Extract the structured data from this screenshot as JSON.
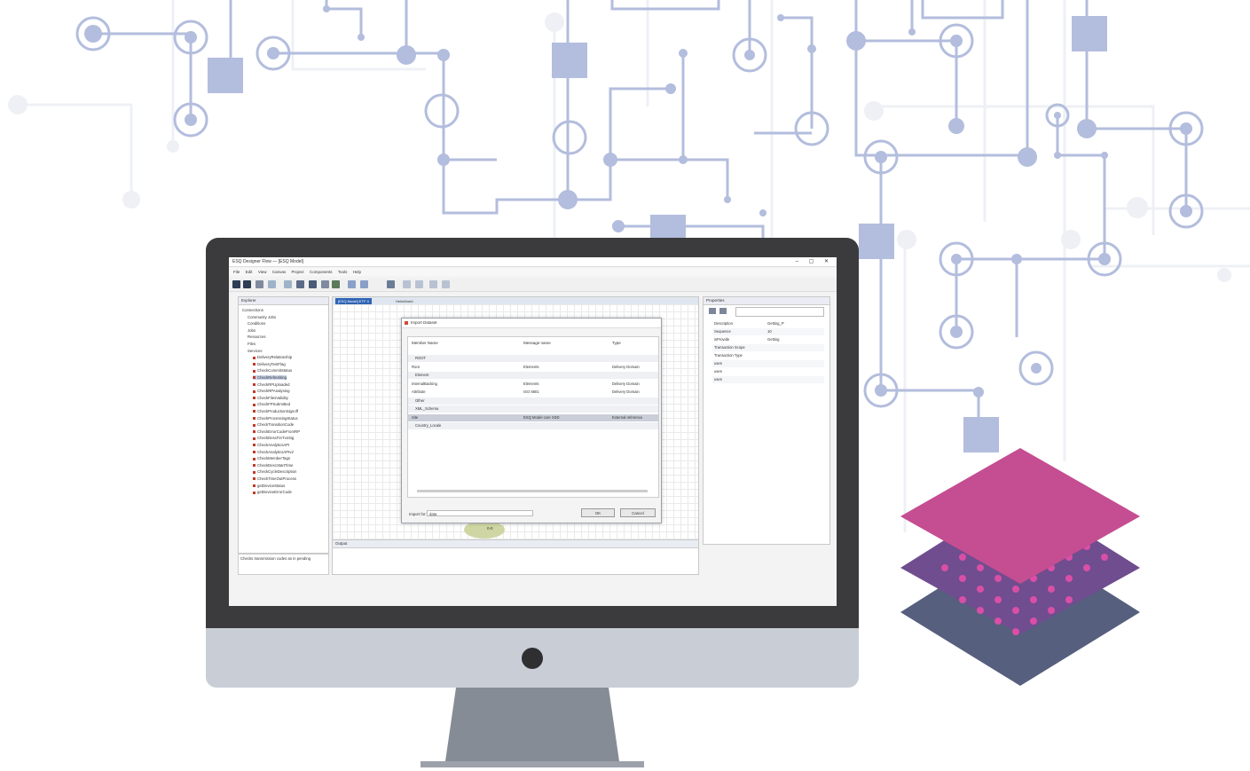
{
  "app": {
    "title": "ESQ Designer Flow — [ESQ Model]",
    "window_buttons": "–  ▢  ✕",
    "menu": [
      "File",
      "Edit",
      "View",
      "Canvas",
      "Project",
      "Components",
      "Tools",
      "Help"
    ]
  },
  "explorer": {
    "header": "Explorer",
    "items": [
      "Connections",
      "Community Jobs",
      "Conditions",
      "Jobs",
      "Resources",
      "Files",
      "Services",
      "DeliveryRelationship",
      "DeliveryTestFlag",
      "CheckCommitStatus",
      "CheckRefreshing",
      "CheckRPUploaded",
      "CheckRPAnalysing",
      "CheckFilesValidity",
      "CheckFPSubmitted",
      "CheckProductionSignoff",
      "CheckProcessingStatus",
      "CheckTransitionCode",
      "CheckErrorCodeFromRP",
      "CheckDescFinTxnSig",
      "CheckAnalyticsAPI",
      "CheckAnalyticsAPIv2",
      "CheckMemberTags",
      "CheckDescStartTime",
      "CheckCycleDescription",
      "CheckTimeOutProcess",
      "getDeviceStatus",
      "getDeviceErrorCode"
    ],
    "status": "Checks transmission codes as in pending"
  },
  "editor": {
    "tab_active": "[ESQ Model] ETF X",
    "tab_2": "HelloWorld"
  },
  "dialog": {
    "title": "Import Dataset",
    "columns": [
      "Member Name",
      "Message name",
      "Type"
    ],
    "rows": [
      {
        "kind": "grp",
        "name": "ROOT",
        "msg": "",
        "type": ""
      },
      {
        "kind": "row",
        "name": "Root",
        "msg": "Elements",
        "type": "Delivery Domain"
      },
      {
        "kind": "grp",
        "name": "Element",
        "msg": "",
        "type": ""
      },
      {
        "kind": "row",
        "name": "InternalBacking",
        "msg": "Elements",
        "type": "Delivery Domain"
      },
      {
        "kind": "row",
        "name": "Attribute",
        "msg": "ISO 8601",
        "type": "Delivery Domain"
      },
      {
        "kind": "grp",
        "name": "Other",
        "msg": "",
        "type": ""
      },
      {
        "kind": "grp",
        "name": "XML_Schema",
        "msg": "",
        "type": ""
      },
      {
        "kind": "hl",
        "name": "Site",
        "msg": "ESQ Model core XSD",
        "type": "External reference"
      },
      {
        "kind": "grp",
        "name": "Country_Locale",
        "msg": "",
        "type": ""
      }
    ],
    "footer_label": "Import for:",
    "footer_value": "data",
    "ok": "OK",
    "cancel": "Cancel"
  },
  "properties": {
    "header": "Properties",
    "rows": [
      {
        "k": "Description",
        "v": "Getting_P"
      },
      {
        "k": "Sequence",
        "v": "10"
      },
      {
        "k": "isProvide",
        "v": "Getting"
      },
      {
        "k": "Transaction Scope",
        "v": ""
      },
      {
        "k": "Transaction Type",
        "v": ""
      },
      {
        "k": "uses",
        "v": ""
      },
      {
        "k": "uses",
        "v": ""
      },
      {
        "k": "uses",
        "v": ""
      }
    ]
  },
  "output": {
    "header": "Output"
  },
  "canvas_node": "0-0",
  "colors": {
    "circuit": "#b3bddd",
    "circuit_light": "#e7eaf2",
    "bezel": "#3b3b3d",
    "chin": "#c9ced6",
    "stand": "#868c96",
    "layer_top": "#c54d91",
    "layer_mid": "#6f4d8f",
    "layer_dots": "#d94fa6",
    "layer_bottom": "#575f7e"
  }
}
